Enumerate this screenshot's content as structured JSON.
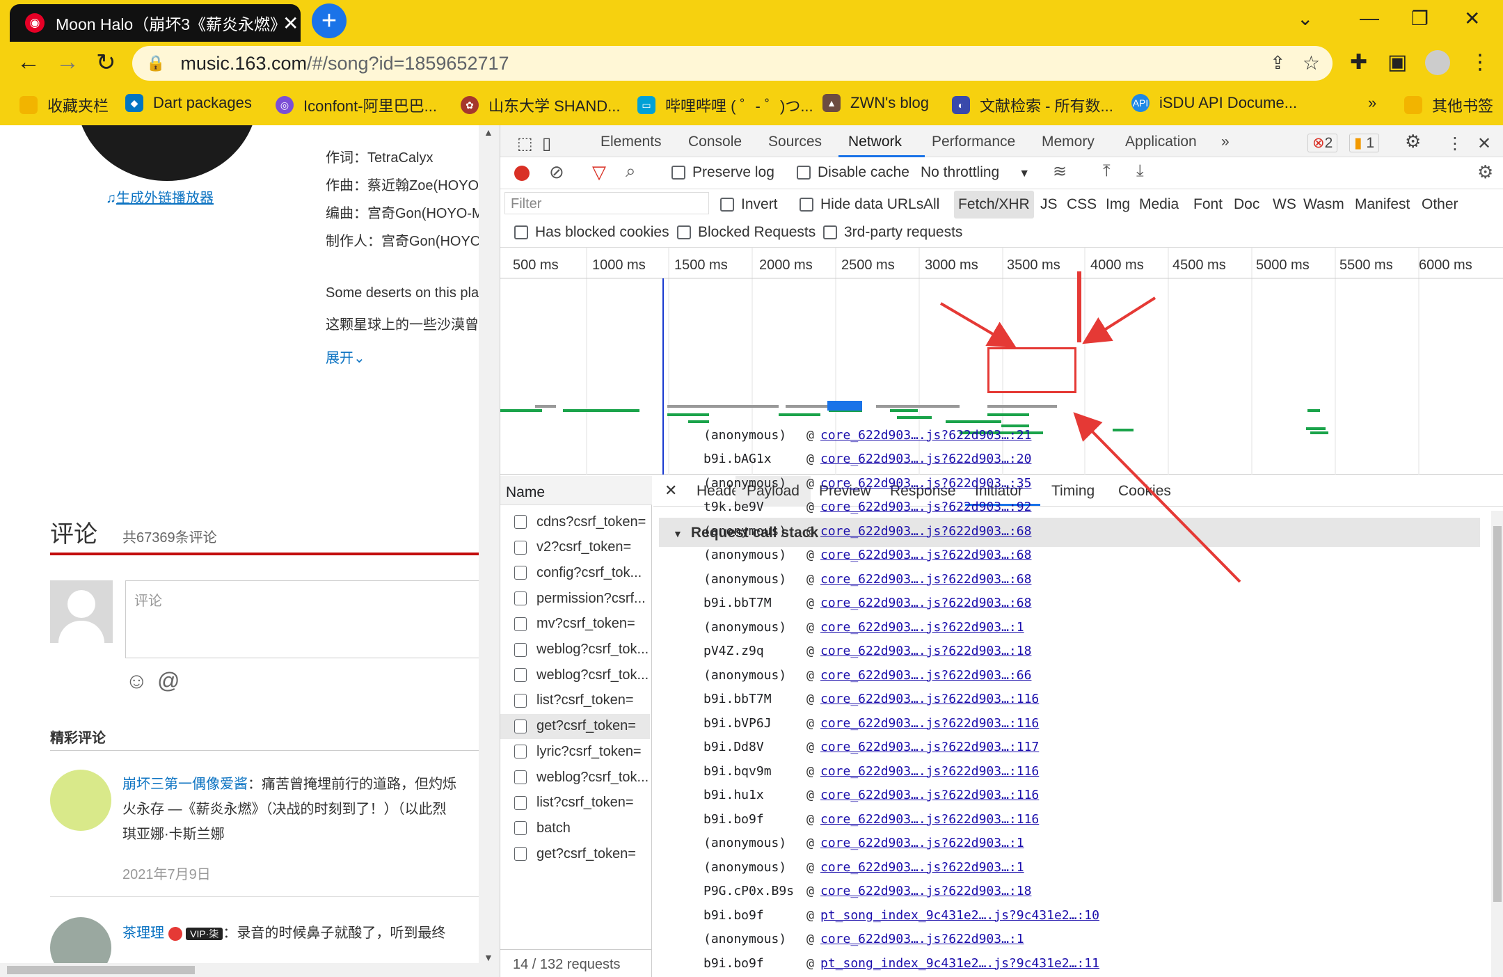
{
  "browser": {
    "tab_title": "Moon Halo（崩坏3《薪炎永燃》",
    "url_host": "music.163.com",
    "url_path": "/#/song?id=1859652717",
    "bookmarks": [
      "收藏夹栏",
      "Dart packages",
      "Iconfont-阿里巴巴...",
      "山东大学 SHAND...",
      "哔哩哔哩 ( ゜- ゜)つ...",
      "ZWN's blog",
      "文献检索 - 所有数...",
      "iSDU API Docume..."
    ],
    "bookmark_overflow": "»",
    "other_bookmarks": "其他书签"
  },
  "song_page": {
    "credits": [
      "作词：TetraCalyx",
      "作曲：蔡近翰Zoe(HOYO",
      "编曲：宫奇Gon(HOYO-M",
      "制作人：宫奇Gon(HOYO"
    ],
    "external_player_link": "生成外链播放器",
    "desc_en": "Some deserts on this pla",
    "desc_zh": "这颗星球上的一些沙漠曾",
    "expand": "展开",
    "comments_title": "评论",
    "comments_count": "共67369条评论",
    "comment_placeholder": "评论",
    "featured_title": "精彩评论",
    "comment1_user": "崩坏三第一偶像爱酱",
    "comment1_text1": "：痛苦曾掩埋前行的道路，但灼烁",
    "comment1_text2": "火永存 —《薪炎永燃》（决战的时刻到了！）（以此烈",
    "comment1_text3": "琪亚娜·卡斯兰娜",
    "comment1_date": "2021年7月9日",
    "comment2_user": "茶理理",
    "comment2_badge": "VIP·柒",
    "comment2_text": "：录音的时候鼻子就酸了，听到最终"
  },
  "devtools": {
    "main_tabs": [
      "Elements",
      "Console",
      "Sources",
      "Network",
      "Performance",
      "Memory",
      "Application"
    ],
    "active_main_tab": "Network",
    "error_count": "2",
    "warning_count": "1",
    "preserve_log": "Preserve log",
    "disable_cache": "Disable cache",
    "throttling": "No throttling",
    "filter_placeholder": "Filter",
    "invert": "Invert",
    "hide_data_urls": "Hide data URLs",
    "type_filters": [
      "All",
      "Fetch/XHR",
      "JS",
      "CSS",
      "Img",
      "Media",
      "Font",
      "Doc",
      "WS",
      "Wasm",
      "Manifest",
      "Other"
    ],
    "active_type_filter": "Fetch/XHR",
    "has_blocked_cookies": "Has blocked cookies",
    "blocked_requests": "Blocked Requests",
    "third_party": "3rd-party requests",
    "timeline_ticks": [
      "500 ms",
      "1000 ms",
      "1500 ms",
      "2000 ms",
      "2500 ms",
      "3000 ms",
      "3500 ms",
      "4000 ms",
      "4500 ms",
      "5000 ms",
      "5500 ms",
      "6000 ms"
    ],
    "name_header": "Name",
    "requests": [
      "cdns?csrf_token=",
      "v2?csrf_token=",
      "config?csrf_tok...",
      "permission?csrf...",
      "mv?csrf_token=",
      "weblog?csrf_tok...",
      "weblog?csrf_tok...",
      "list?csrf_token=",
      "get?csrf_token=",
      "lyric?csrf_token=",
      "weblog?csrf_tok...",
      "list?csrf_token=",
      "batch",
      "get?csrf_token="
    ],
    "selected_request_index": 8,
    "status_bar": "14 / 132 requests",
    "detail_tabs": [
      "Headers",
      "Payload",
      "Preview",
      "Response",
      "Initiator",
      "Timing",
      "Cookies"
    ],
    "active_detail_tab": "Initiator",
    "stack_title": "Request call stack",
    "stack": [
      {
        "fn": "(anonymous)",
        "src": "core_622d903….js?622d903…:21"
      },
      {
        "fn": "b9i.bAG1x",
        "src": "core_622d903….js?622d903…:20"
      },
      {
        "fn": "(anonymous)",
        "src": "core_622d903….js?622d903…:35"
      },
      {
        "fn": "t9k.be9V",
        "src": "core_622d903….js?622d903…:92"
      },
      {
        "fn": "(anonymous)",
        "src": "core_622d903….js?622d903…:68"
      },
      {
        "fn": "(anonymous)",
        "src": "core_622d903….js?622d903…:68"
      },
      {
        "fn": "(anonymous)",
        "src": "core_622d903….js?622d903…:68"
      },
      {
        "fn": "b9i.bbT7M",
        "src": "core_622d903….js?622d903…:68"
      },
      {
        "fn": "(anonymous)",
        "src": "core_622d903….js?622d903…:1"
      },
      {
        "fn": "pV4Z.z9q",
        "src": "core_622d903….js?622d903…:18"
      },
      {
        "fn": "(anonymous)",
        "src": "core_622d903….js?622d903…:66"
      },
      {
        "fn": "b9i.bbT7M",
        "src": "core_622d903….js?622d903…:116"
      },
      {
        "fn": "b9i.bVP6J",
        "src": "core_622d903….js?622d903…:116"
      },
      {
        "fn": "b9i.Dd8V",
        "src": "core_622d903….js?622d903…:117"
      },
      {
        "fn": "b9i.bqv9m",
        "src": "core_622d903….js?622d903…:116"
      },
      {
        "fn": "b9i.hu1x",
        "src": "core_622d903….js?622d903…:116"
      },
      {
        "fn": "b9i.bo9f",
        "src": "core_622d903….js?622d903…:116"
      },
      {
        "fn": "(anonymous)",
        "src": "core_622d903….js?622d903…:1"
      },
      {
        "fn": "(anonymous)",
        "src": "core_622d903….js?622d903…:1"
      },
      {
        "fn": "P9G.cP0x.B9s",
        "src": "core_622d903….js?622d903…:18"
      },
      {
        "fn": "b9i.bo9f",
        "src": "pt_song_index_9c431e2….js?9c431e2…:10"
      },
      {
        "fn": "(anonymous)",
        "src": "core_622d903….js?622d903…:1"
      },
      {
        "fn": "b9i.bo9f",
        "src": "pt_song_index_9c431e2….js?9c431e2…:11"
      }
    ]
  },
  "colors": {
    "chrome_yellow": "#f6d10f",
    "link": "#1a0dab",
    "highlight_red": "#e53935",
    "netease_red": "#c20c0c"
  }
}
